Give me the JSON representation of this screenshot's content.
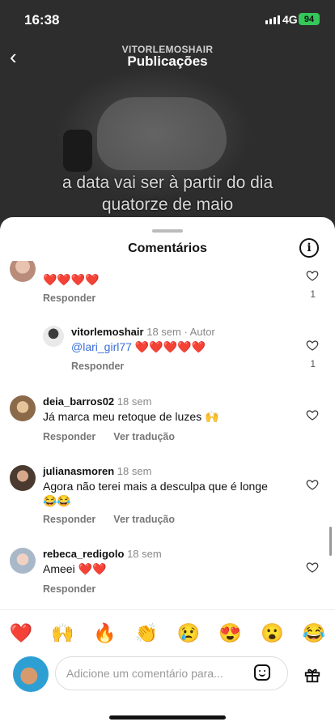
{
  "status": {
    "time": "16:38",
    "network": "4G",
    "battery": "94"
  },
  "header": {
    "account": "VITORLEMOSHAIR",
    "title": "Publicações"
  },
  "video": {
    "caption_line1": "a data vai ser à partir do dia",
    "caption_line2": "quatorze de maio"
  },
  "sheet": {
    "title": "Comentários"
  },
  "comments": [
    {
      "username": "",
      "text": "❤️❤️❤️❤️",
      "reply_label": "Responder",
      "likes": "1"
    },
    {
      "username": "vitorlemoshair",
      "meta": "18 sem · Autor",
      "mention": "@lari_girl77",
      "text": " ❤️❤️❤️❤️❤️",
      "reply_label": "Responder",
      "likes": "1"
    },
    {
      "username": "deia_barros02",
      "meta": "18 sem",
      "text": "Já marca meu retoque de luzes 🙌",
      "reply_label": "Responder",
      "translate_label": "Ver tradução"
    },
    {
      "username": "julianasmoren",
      "meta": "18 sem",
      "text_line1": "Agora não terei mais a desculpa que é longe",
      "text_line2": "😂😂",
      "reply_label": "Responder",
      "translate_label": "Ver tradução"
    },
    {
      "username": "rebeca_redigolo",
      "meta": "18 sem",
      "text": "Ameei ❤️❤️",
      "reply_label": "Responder"
    }
  ],
  "emojis": [
    "❤️",
    "🙌",
    "🔥",
    "👏",
    "😢",
    "😍",
    "😮",
    "😂"
  ],
  "input": {
    "placeholder": "Adicione um comentário para..."
  },
  "icons": {
    "back": "chevron-left-icon",
    "info": "info-icon",
    "like": "heart-outline-icon",
    "sticker": "sticker-icon",
    "gift": "gift-icon"
  },
  "colors": {
    "battery": "#34c759",
    "mention": "#3a6fd8"
  }
}
